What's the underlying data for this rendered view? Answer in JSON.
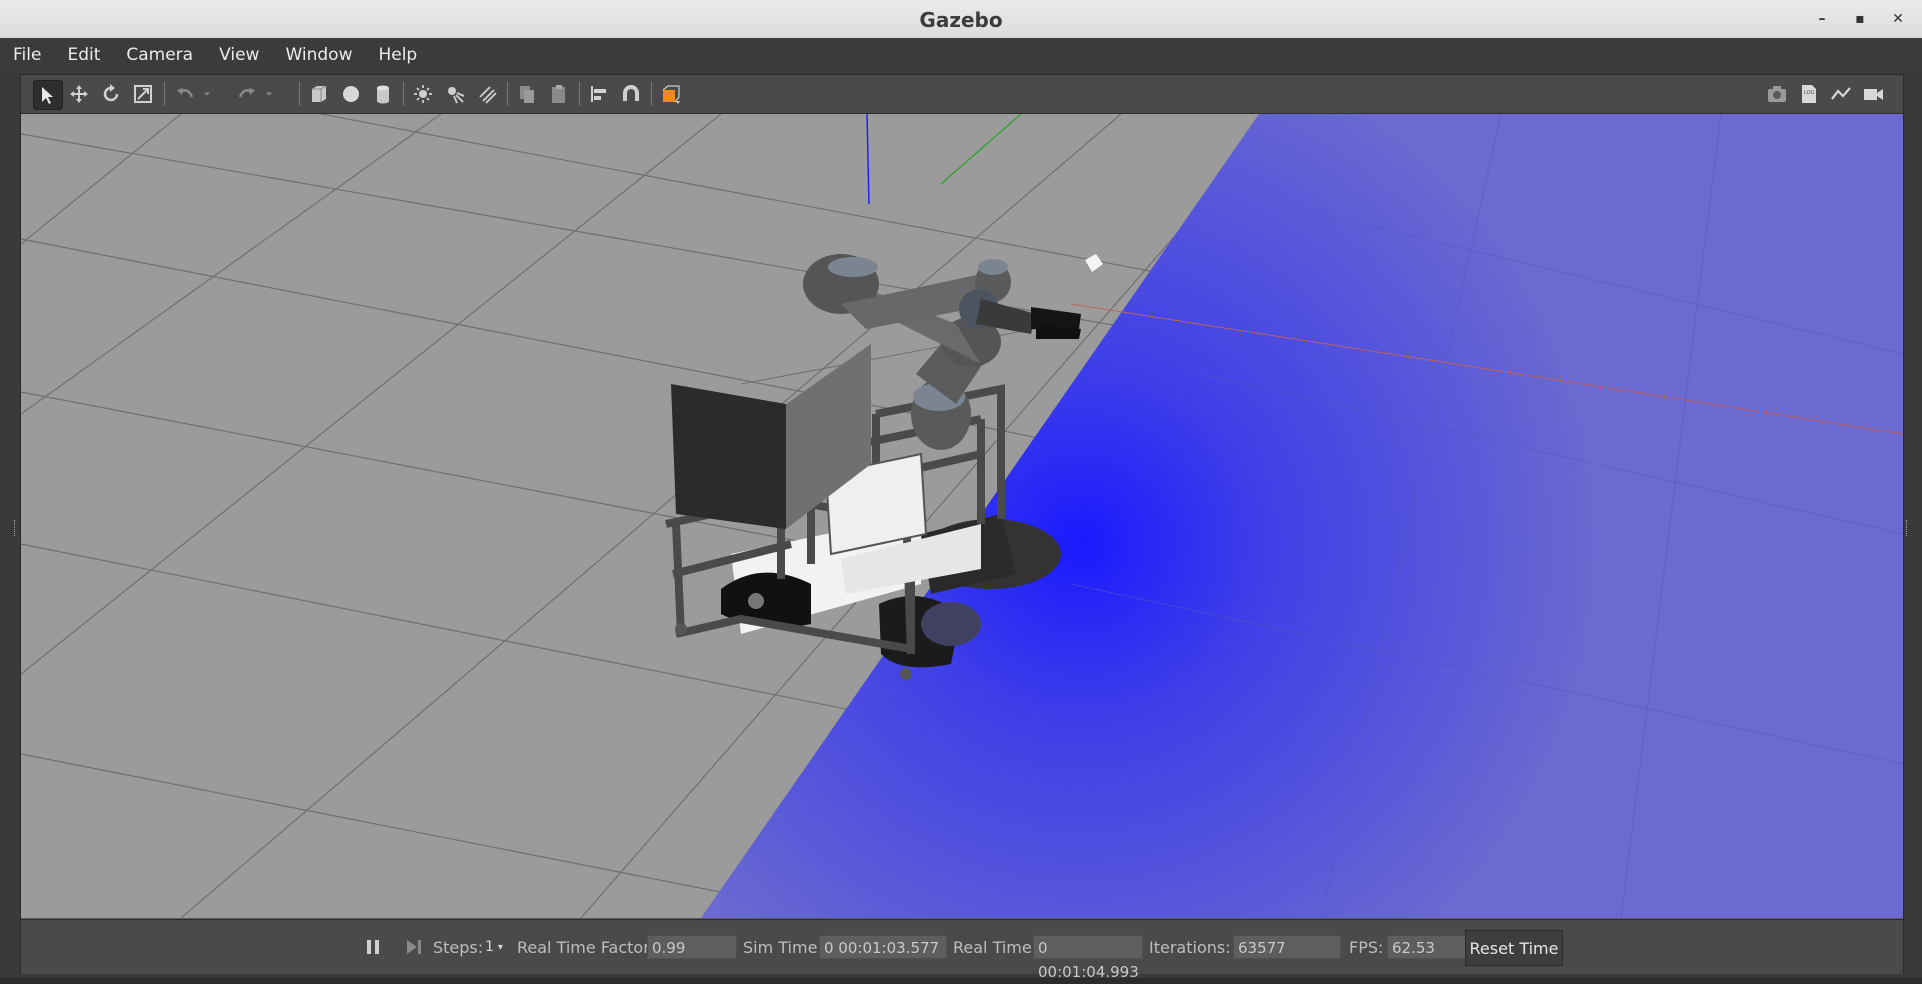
{
  "window": {
    "title": "Gazebo"
  },
  "menu": [
    "File",
    "Edit",
    "Camera",
    "View",
    "Window",
    "Help"
  ],
  "toolbar": {
    "left_icons": [
      "select-arrow-icon",
      "translate-icon",
      "rotate-icon",
      "scale-icon",
      "undo-icon",
      "undo-dropdown-icon",
      "redo-icon",
      "redo-dropdown-icon",
      "box-icon",
      "sphere-icon",
      "cylinder-icon",
      "point-light-icon",
      "spot-light-icon",
      "directional-light-icon",
      "copy-icon",
      "paste-icon",
      "align-icon",
      "snap-magnet-icon",
      "view-angle-icon"
    ],
    "right_icons": [
      "screenshot-icon",
      "log-icon",
      "plot-icon",
      "record-video-icon"
    ]
  },
  "status": {
    "steps_label": "Steps:",
    "steps_value": "1",
    "rtf_label": "Real Time Factor:",
    "rtf_value": "0.99",
    "sim_time_label": "Sim Time:",
    "sim_time_value": "0 00:01:03.577",
    "real_time_label": "Real Time:",
    "real_time_value": "0 00:01:04.993",
    "iterations_label": "Iterations:",
    "iterations_value": "63577",
    "fps_label": "FPS:",
    "fps_value": "62.53",
    "reset_label": "Reset Time"
  },
  "colors": {
    "laser": "#3a3af0",
    "ground": "#9a9a9a",
    "chrome": "#4a4a4a"
  }
}
